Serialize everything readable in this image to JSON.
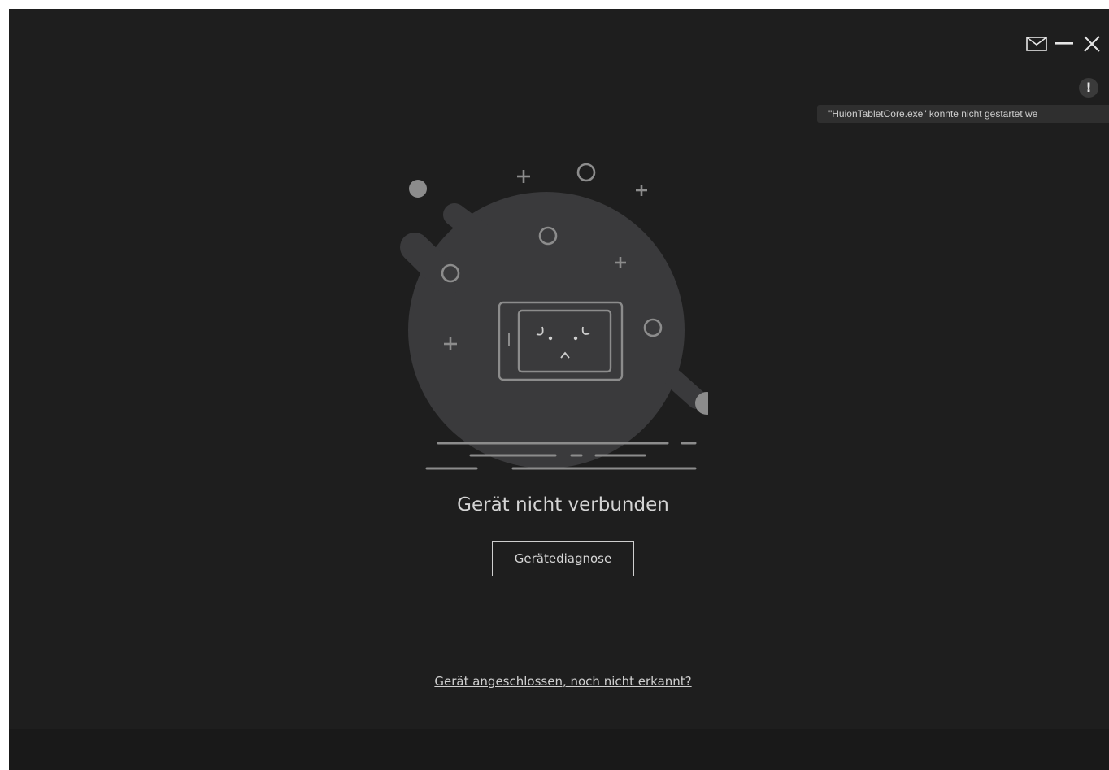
{
  "window": {
    "controls": {
      "mail_icon": "mail-icon",
      "minimize_icon": "minimize-icon",
      "close_icon": "close-icon"
    },
    "warning": {
      "badge_label": "!",
      "tooltip": "\"HuionTabletCore.exe\" konnte nicht gestartet we"
    }
  },
  "main": {
    "illustration_icon": "tablet-disconnected-illustration",
    "status_title": "Gerät nicht verbunden",
    "diagnose_button": "Gerätediagnose",
    "help_link": "Gerät angeschlossen, noch nicht erkannt?"
  },
  "colors": {
    "background": "#1e1e1e",
    "footer": "#191919",
    "illustration_fill": "#3a3a3c",
    "line": "#8c8c8c",
    "text": "#d4d4d4"
  }
}
